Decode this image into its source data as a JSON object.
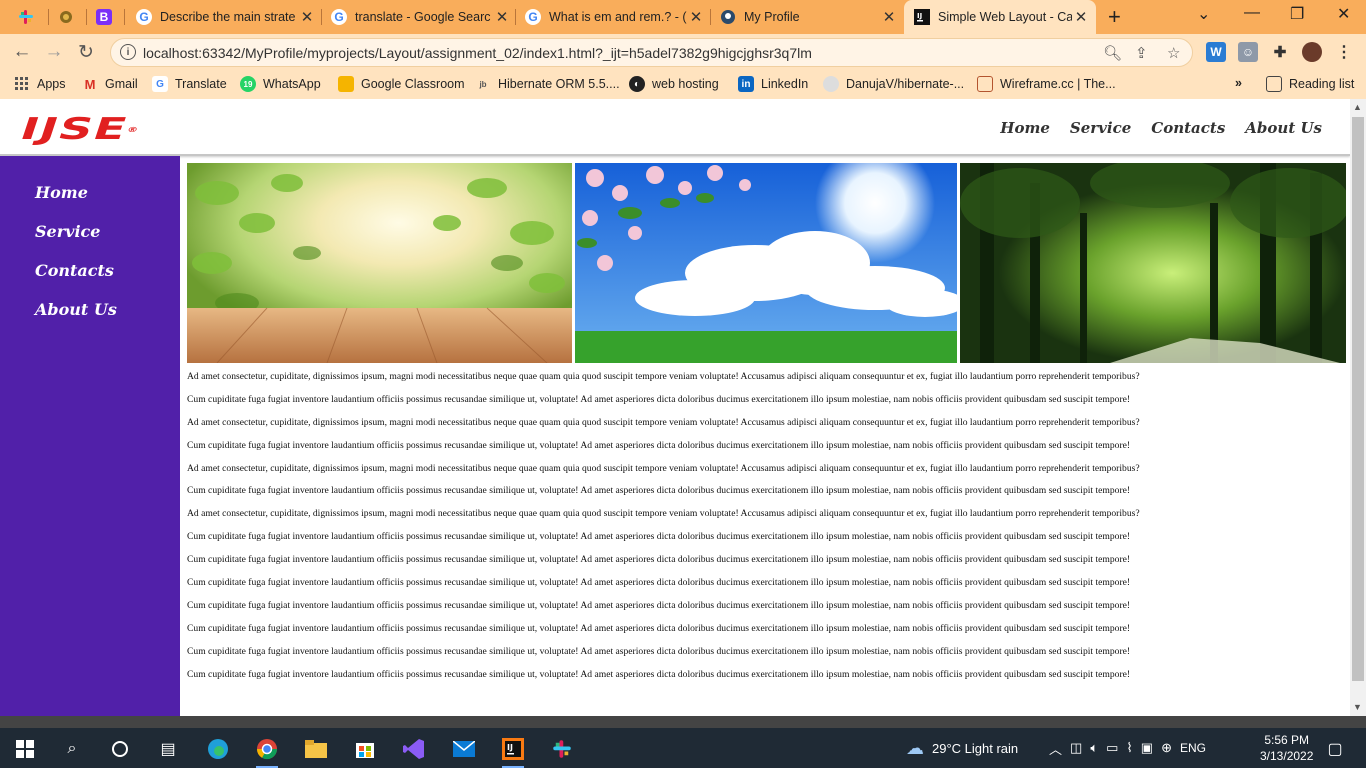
{
  "browser": {
    "tabs": [
      {
        "title": "",
        "icon": "slack-icon"
      },
      {
        "title": "",
        "icon": "emblem-icon"
      },
      {
        "title": "",
        "icon": "bootstrap-icon",
        "glyph": "B"
      },
      {
        "title": "Describe the main strate",
        "icon": "google-icon"
      },
      {
        "title": "translate - Google Searc",
        "icon": "google-icon"
      },
      {
        "title": "What is em and rem.? - (",
        "icon": "google-icon"
      },
      {
        "title": "My Profile",
        "icon": "profile-icon"
      },
      {
        "title": "Simple Web Layout - Ca",
        "icon": "intellij-icon",
        "active": true
      }
    ],
    "url": "localhost:63342/MyProfile/myprojects/Layout/assignment_02/index1.html?_ijt=h5adel7382g9higcjghsr3q7lm",
    "bookmarks": [
      {
        "label": "Apps",
        "icon": "apps-grid-icon"
      },
      {
        "label": "Gmail",
        "icon": "gmail-icon"
      },
      {
        "label": "Translate",
        "icon": "google-icon"
      },
      {
        "label": "WhatsApp",
        "icon": "whatsapp-icon"
      },
      {
        "label": "Google Classroom",
        "icon": "classroom-icon"
      },
      {
        "label": "Hibernate ORM 5.5....",
        "icon": "hibernate-icon"
      },
      {
        "label": "web hosting",
        "icon": "globe-icon"
      },
      {
        "label": "LinkedIn",
        "icon": "linkedin-icon"
      },
      {
        "label": "DanujaV/hibernate-...",
        "icon": "github-icon"
      },
      {
        "label": "Wireframe.cc | The...",
        "icon": "wireframe-icon"
      }
    ],
    "more_bookmarks": "»",
    "reading_list": "Reading list"
  },
  "site": {
    "logo_text": "IJSE",
    "logo_mark": "®",
    "topnav": [
      "Home",
      "Service",
      "Contacts",
      "About Us"
    ],
    "sidenav": [
      "Home",
      "Service",
      "Contacts",
      "About Us"
    ],
    "images": [
      {
        "alt": "sunlit leaves over wooden table",
        "colors": [
          "#a8d86a",
          "#f5f0c8",
          "#c88650"
        ]
      },
      {
        "alt": "cherry blossom with sunny sky and grass",
        "colors": [
          "#2f7ee0",
          "#ffffff",
          "#2f9b2a"
        ]
      },
      {
        "alt": "forest path with green trees",
        "colors": [
          "#1f3a12",
          "#9fd15a",
          "#0d1f08"
        ]
      }
    ],
    "paragraphs": [
      "Ad amet consectetur, cupiditate, dignissimos ipsum, magni modi necessitatibus neque quae quam quia quod suscipit tempore veniam voluptate! Accusamus adipisci aliquam consequuntur et ex, fugiat illo laudantium porro reprehenderit temporibus?",
      "Cum cupiditate fuga fugiat inventore laudantium officiis possimus recusandae similique ut, voluptate! Ad amet asperiores dicta doloribus ducimus exercitationem illo ipsum molestiae, nam nobis officiis provident quibusdam sed suscipit tempore!",
      "Ad amet consectetur, cupiditate, dignissimos ipsum, magni modi necessitatibus neque quae quam quia quod suscipit tempore veniam voluptate! Accusamus adipisci aliquam consequuntur et ex, fugiat illo laudantium porro reprehenderit temporibus?",
      "Cum cupiditate fuga fugiat inventore laudantium officiis possimus recusandae similique ut, voluptate! Ad amet asperiores dicta doloribus ducimus exercitationem illo ipsum molestiae, nam nobis officiis provident quibusdam sed suscipit tempore!",
      "Ad amet consectetur, cupiditate, dignissimos ipsum, magni modi necessitatibus neque quae quam quia quod suscipit tempore veniam voluptate! Accusamus adipisci aliquam consequuntur et ex, fugiat illo laudantium porro reprehenderit temporibus?",
      "Cum cupiditate fuga fugiat inventore laudantium officiis possimus recusandae similique ut, voluptate! Ad amet asperiores dicta doloribus ducimus exercitationem illo ipsum molestiae, nam nobis officiis provident quibusdam sed suscipit tempore!",
      "Ad amet consectetur, cupiditate, dignissimos ipsum, magni modi necessitatibus neque quae quam quia quod suscipit tempore veniam voluptate! Accusamus adipisci aliquam consequuntur et ex, fugiat illo laudantium porro reprehenderit temporibus?",
      "Cum cupiditate fuga fugiat inventore laudantium officiis possimus recusandae similique ut, voluptate! Ad amet asperiores dicta doloribus ducimus exercitationem illo ipsum molestiae, nam nobis officiis provident quibusdam sed suscipit tempore!",
      "Cum cupiditate fuga fugiat inventore laudantium officiis possimus recusandae similique ut, voluptate! Ad amet asperiores dicta doloribus ducimus exercitationem illo ipsum molestiae, nam nobis officiis provident quibusdam sed suscipit tempore!",
      "Cum cupiditate fuga fugiat inventore laudantium officiis possimus recusandae similique ut, voluptate! Ad amet asperiores dicta doloribus ducimus exercitationem illo ipsum molestiae, nam nobis officiis provident quibusdam sed suscipit tempore!",
      "Cum cupiditate fuga fugiat inventore laudantium officiis possimus recusandae similique ut, voluptate! Ad amet asperiores dicta doloribus ducimus exercitationem illo ipsum molestiae, nam nobis officiis provident quibusdam sed suscipit tempore!",
      "Cum cupiditate fuga fugiat inventore laudantium officiis possimus recusandae similique ut, voluptate! Ad amet asperiores dicta doloribus ducimus exercitationem illo ipsum molestiae, nam nobis officiis provident quibusdam sed suscipit tempore!",
      "Cum cupiditate fuga fugiat inventore laudantium officiis possimus recusandae similique ut, voluptate! Ad amet asperiores dicta doloribus ducimus exercitationem illo ipsum molestiae, nam nobis officiis provident quibusdam sed suscipit tempore!",
      "Cum cupiditate fuga fugiat inventore laudantium officiis possimus recusandae similique ut, voluptate! Ad amet asperiores dicta doloribus ducimus exercitationem illo ipsum molestiae, nam nobis officiis provident quibusdam sed suscipit tempore!"
    ],
    "colors": {
      "sidebar": "#5120a9",
      "logo": "#e12020",
      "tabstrip": "#f9ad5b",
      "toolbar": "#ffe3bf"
    }
  },
  "taskbar": {
    "weather": "29°C  Light rain",
    "language": "ENG",
    "time": "5:56 PM",
    "date": "3/13/2022",
    "apps": [
      "windows-start-icon",
      "search-icon",
      "cortana-icon",
      "task-view-icon",
      "edge-icon",
      "chrome-icon",
      "file-explorer-icon",
      "store-icon",
      "visual-studio-icon",
      "mail-icon",
      "intellij-icon",
      "slack-icon"
    ]
  }
}
